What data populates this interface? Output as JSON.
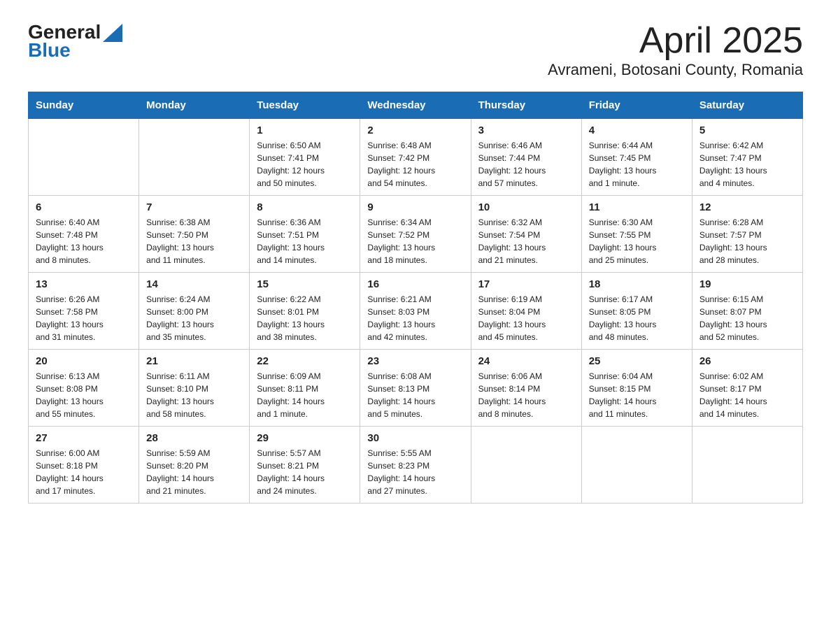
{
  "header": {
    "logo_general": "General",
    "logo_blue": "Blue",
    "title": "April 2025",
    "subtitle": "Avrameni, Botosani County, Romania"
  },
  "calendar": {
    "days_of_week": [
      "Sunday",
      "Monday",
      "Tuesday",
      "Wednesday",
      "Thursday",
      "Friday",
      "Saturday"
    ],
    "weeks": [
      [
        {
          "day": "",
          "info": ""
        },
        {
          "day": "",
          "info": ""
        },
        {
          "day": "1",
          "info": "Sunrise: 6:50 AM\nSunset: 7:41 PM\nDaylight: 12 hours\nand 50 minutes."
        },
        {
          "day": "2",
          "info": "Sunrise: 6:48 AM\nSunset: 7:42 PM\nDaylight: 12 hours\nand 54 minutes."
        },
        {
          "day": "3",
          "info": "Sunrise: 6:46 AM\nSunset: 7:44 PM\nDaylight: 12 hours\nand 57 minutes."
        },
        {
          "day": "4",
          "info": "Sunrise: 6:44 AM\nSunset: 7:45 PM\nDaylight: 13 hours\nand 1 minute."
        },
        {
          "day": "5",
          "info": "Sunrise: 6:42 AM\nSunset: 7:47 PM\nDaylight: 13 hours\nand 4 minutes."
        }
      ],
      [
        {
          "day": "6",
          "info": "Sunrise: 6:40 AM\nSunset: 7:48 PM\nDaylight: 13 hours\nand 8 minutes."
        },
        {
          "day": "7",
          "info": "Sunrise: 6:38 AM\nSunset: 7:50 PM\nDaylight: 13 hours\nand 11 minutes."
        },
        {
          "day": "8",
          "info": "Sunrise: 6:36 AM\nSunset: 7:51 PM\nDaylight: 13 hours\nand 14 minutes."
        },
        {
          "day": "9",
          "info": "Sunrise: 6:34 AM\nSunset: 7:52 PM\nDaylight: 13 hours\nand 18 minutes."
        },
        {
          "day": "10",
          "info": "Sunrise: 6:32 AM\nSunset: 7:54 PM\nDaylight: 13 hours\nand 21 minutes."
        },
        {
          "day": "11",
          "info": "Sunrise: 6:30 AM\nSunset: 7:55 PM\nDaylight: 13 hours\nand 25 minutes."
        },
        {
          "day": "12",
          "info": "Sunrise: 6:28 AM\nSunset: 7:57 PM\nDaylight: 13 hours\nand 28 minutes."
        }
      ],
      [
        {
          "day": "13",
          "info": "Sunrise: 6:26 AM\nSunset: 7:58 PM\nDaylight: 13 hours\nand 31 minutes."
        },
        {
          "day": "14",
          "info": "Sunrise: 6:24 AM\nSunset: 8:00 PM\nDaylight: 13 hours\nand 35 minutes."
        },
        {
          "day": "15",
          "info": "Sunrise: 6:22 AM\nSunset: 8:01 PM\nDaylight: 13 hours\nand 38 minutes."
        },
        {
          "day": "16",
          "info": "Sunrise: 6:21 AM\nSunset: 8:03 PM\nDaylight: 13 hours\nand 42 minutes."
        },
        {
          "day": "17",
          "info": "Sunrise: 6:19 AM\nSunset: 8:04 PM\nDaylight: 13 hours\nand 45 minutes."
        },
        {
          "day": "18",
          "info": "Sunrise: 6:17 AM\nSunset: 8:05 PM\nDaylight: 13 hours\nand 48 minutes."
        },
        {
          "day": "19",
          "info": "Sunrise: 6:15 AM\nSunset: 8:07 PM\nDaylight: 13 hours\nand 52 minutes."
        }
      ],
      [
        {
          "day": "20",
          "info": "Sunrise: 6:13 AM\nSunset: 8:08 PM\nDaylight: 13 hours\nand 55 minutes."
        },
        {
          "day": "21",
          "info": "Sunrise: 6:11 AM\nSunset: 8:10 PM\nDaylight: 13 hours\nand 58 minutes."
        },
        {
          "day": "22",
          "info": "Sunrise: 6:09 AM\nSunset: 8:11 PM\nDaylight: 14 hours\nand 1 minute."
        },
        {
          "day": "23",
          "info": "Sunrise: 6:08 AM\nSunset: 8:13 PM\nDaylight: 14 hours\nand 5 minutes."
        },
        {
          "day": "24",
          "info": "Sunrise: 6:06 AM\nSunset: 8:14 PM\nDaylight: 14 hours\nand 8 minutes."
        },
        {
          "day": "25",
          "info": "Sunrise: 6:04 AM\nSunset: 8:15 PM\nDaylight: 14 hours\nand 11 minutes."
        },
        {
          "day": "26",
          "info": "Sunrise: 6:02 AM\nSunset: 8:17 PM\nDaylight: 14 hours\nand 14 minutes."
        }
      ],
      [
        {
          "day": "27",
          "info": "Sunrise: 6:00 AM\nSunset: 8:18 PM\nDaylight: 14 hours\nand 17 minutes."
        },
        {
          "day": "28",
          "info": "Sunrise: 5:59 AM\nSunset: 8:20 PM\nDaylight: 14 hours\nand 21 minutes."
        },
        {
          "day": "29",
          "info": "Sunrise: 5:57 AM\nSunset: 8:21 PM\nDaylight: 14 hours\nand 24 minutes."
        },
        {
          "day": "30",
          "info": "Sunrise: 5:55 AM\nSunset: 8:23 PM\nDaylight: 14 hours\nand 27 minutes."
        },
        {
          "day": "",
          "info": ""
        },
        {
          "day": "",
          "info": ""
        },
        {
          "day": "",
          "info": ""
        }
      ]
    ]
  }
}
